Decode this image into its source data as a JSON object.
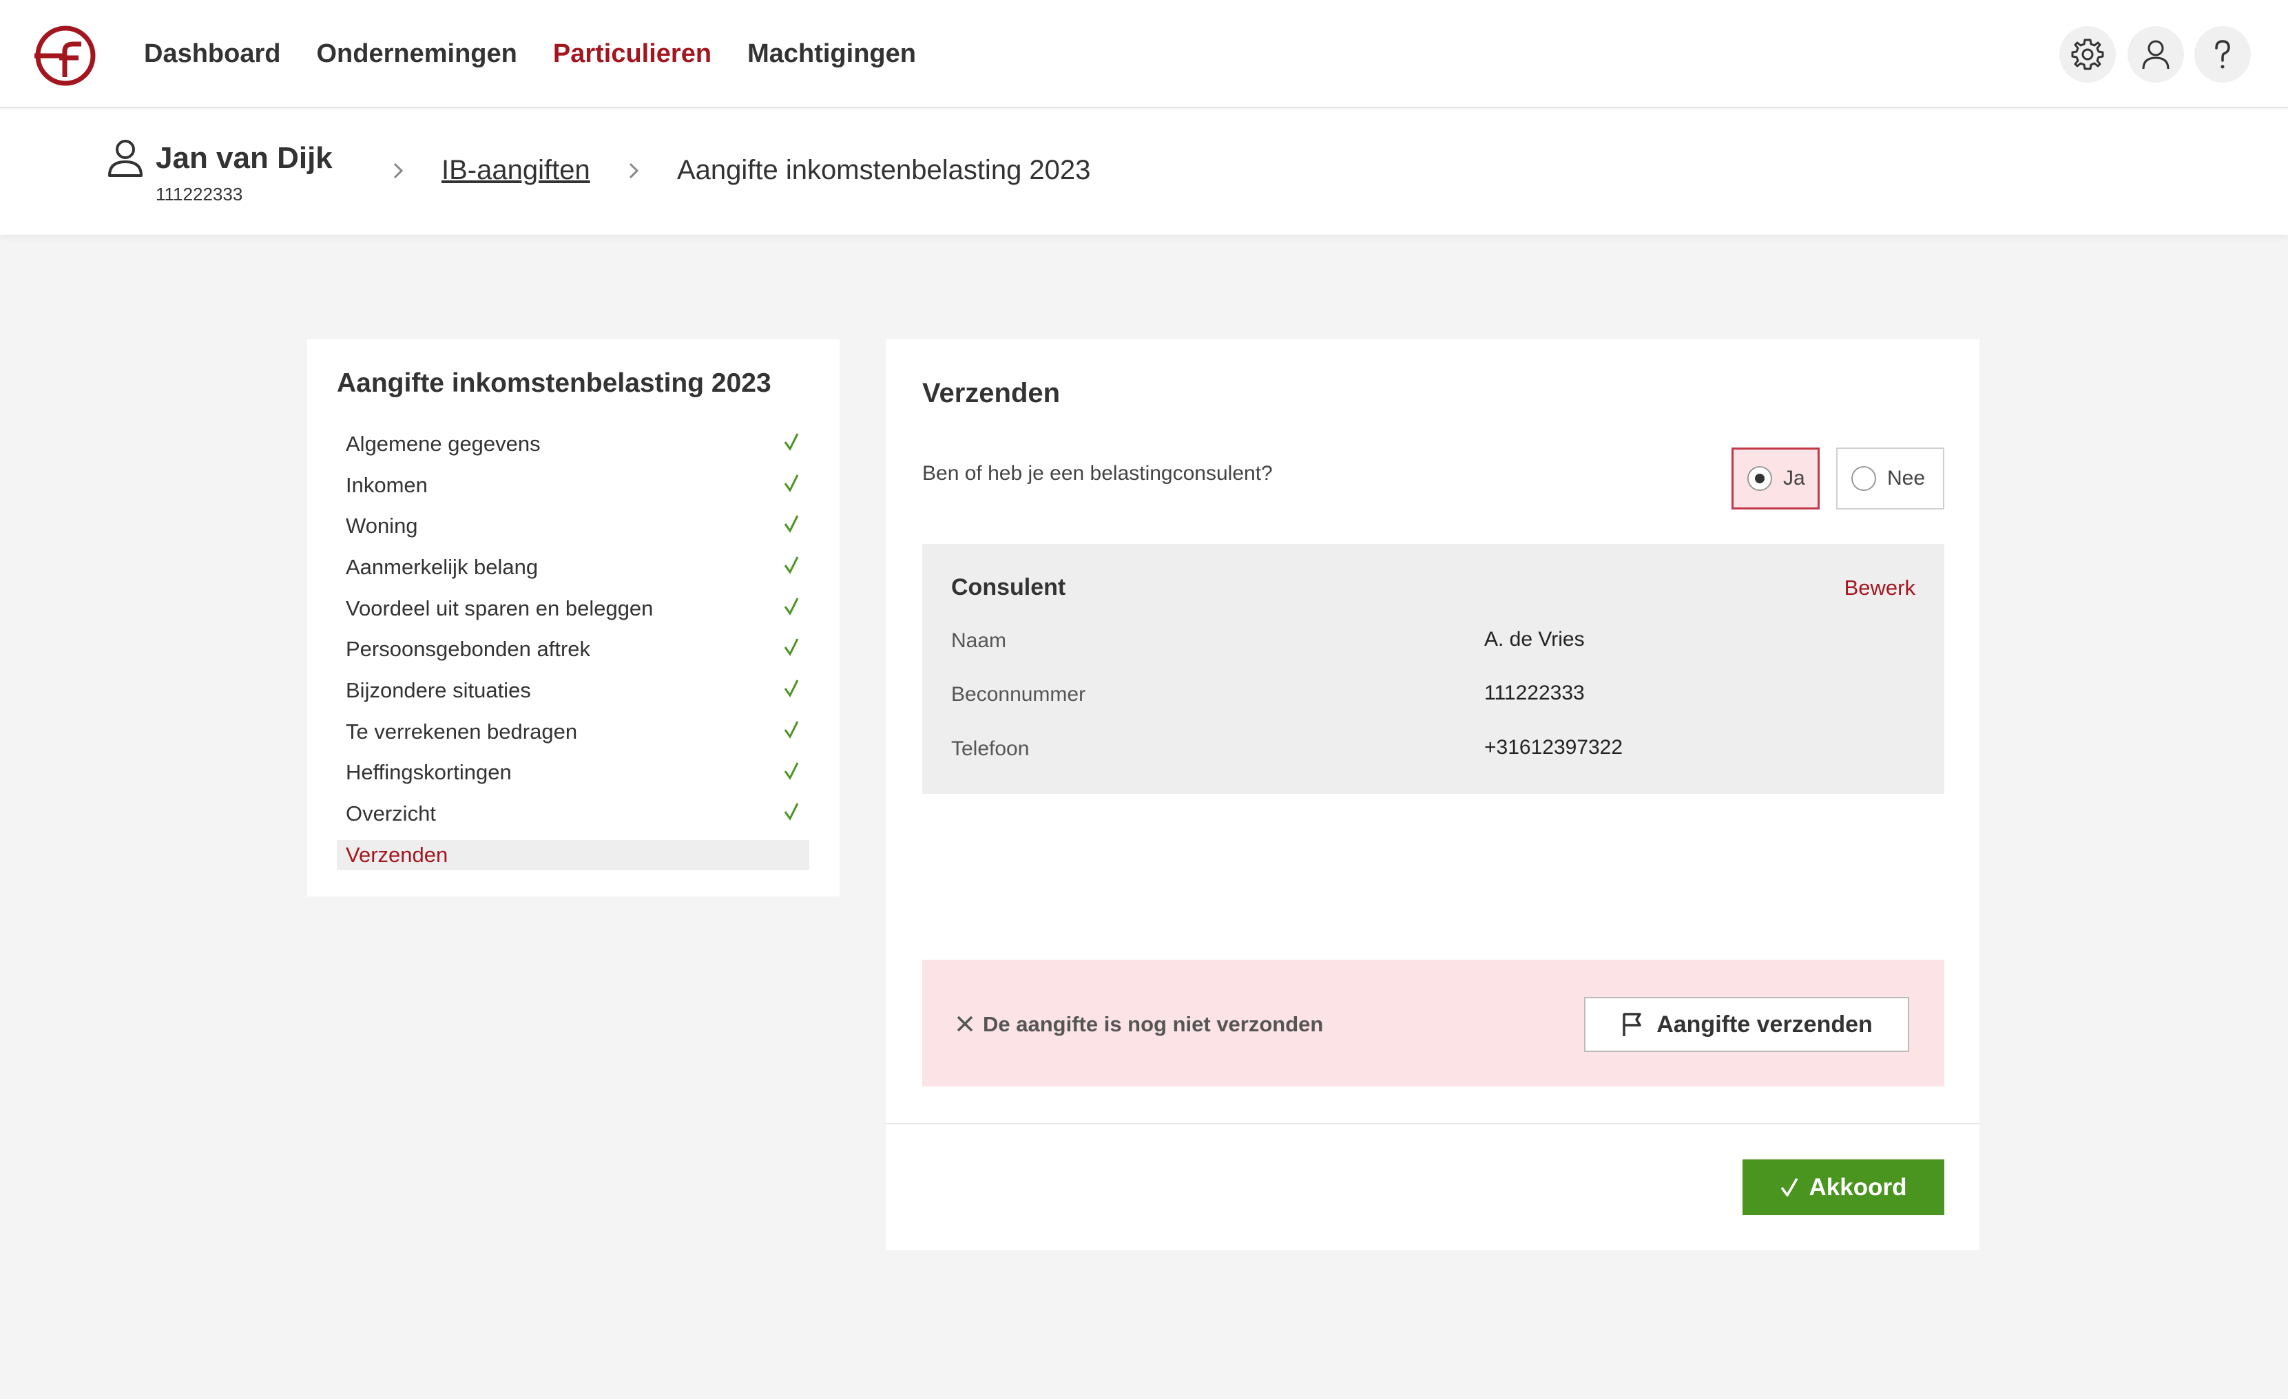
{
  "colors": {
    "brand": "#a4161f",
    "success": "#4a9420",
    "alert_bg": "#fbe3e6",
    "page_bg": "#f4f4f4"
  },
  "nav": {
    "items": [
      {
        "label": "Dashboard",
        "active": false
      },
      {
        "label": "Ondernemingen",
        "active": false
      },
      {
        "label": "Particulieren",
        "active": true
      },
      {
        "label": "Machtigingen",
        "active": false
      }
    ],
    "icons": [
      "gear-icon",
      "user-icon",
      "help-icon"
    ]
  },
  "client": {
    "name": "Jan van Dijk",
    "id": "111222333"
  },
  "breadcrumb": {
    "link": "IB-aangiften",
    "current": "Aangifte inkomstenbelasting 2023"
  },
  "sidebar": {
    "title": "Aangifte inkomstenbelasting 2023",
    "items": [
      {
        "label": "Algemene gegevens",
        "done": true
      },
      {
        "label": "Inkomen",
        "done": true
      },
      {
        "label": "Woning",
        "done": true
      },
      {
        "label": "Aanmerkelijk belang",
        "done": true
      },
      {
        "label": "Voordeel uit sparen en beleggen",
        "done": true
      },
      {
        "label": "Persoonsgebonden aftrek",
        "done": true
      },
      {
        "label": "Bijzondere situaties",
        "done": true
      },
      {
        "label": "Te verrekenen bedragen",
        "done": true
      },
      {
        "label": "Heffingskortingen",
        "done": true
      },
      {
        "label": "Overzicht",
        "done": true
      },
      {
        "label": "Verzenden",
        "done": false,
        "active": true
      }
    ]
  },
  "main": {
    "title": "Verzenden",
    "question": "Ben of heb je een belastingconsulent?",
    "options": [
      {
        "label": "Ja",
        "checked": true
      },
      {
        "label": "Nee",
        "checked": false
      }
    ],
    "consultant": {
      "title": "Consulent",
      "edit": "Bewerk",
      "rows": [
        {
          "label": "Naam",
          "value": "A. de Vries"
        },
        {
          "label": "Beconnummer",
          "value": "111222333"
        },
        {
          "label": "Telefoon",
          "value": "+31612397322"
        }
      ]
    },
    "alert": {
      "text": "De aangifte is nog niet verzonden",
      "button": "Aangifte verzenden"
    },
    "confirm": "Akkoord"
  }
}
